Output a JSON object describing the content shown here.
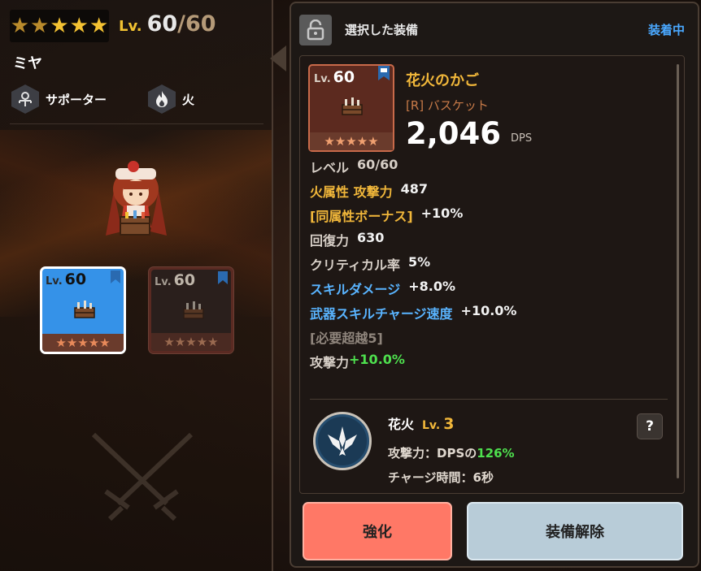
{
  "colors": {
    "accent_gold": "#f1b73a",
    "skill_blue": "#59b4ff",
    "bonus_green": "#4ee04e",
    "equipped_status": "#4aa8ff",
    "upgrade_button": "#ff7866",
    "unequip_button": "#b8ccd8",
    "equipped_slot": "#3592e8"
  },
  "character": {
    "stars": 5,
    "lit_stars": 3,
    "level_label": "Lv.",
    "level": "60",
    "level_max": "/60",
    "name": "ミヤ",
    "role_icon": "support-icon",
    "role": "サポーター",
    "element_icon": "fire-icon",
    "element": "火"
  },
  "slots": [
    {
      "lv_label": "Lv.",
      "level": "60",
      "stars": "★★★★★",
      "state": "equipped",
      "icon": "basket-icon"
    },
    {
      "lv_label": "Lv.",
      "level": "60",
      "stars": "★★★★★",
      "state": "owned",
      "icon": "basket-icon"
    }
  ],
  "panel": {
    "lock_icon": "unlock-icon",
    "title": "選択した装備",
    "status": "装着中"
  },
  "item": {
    "lv_label": "Lv.",
    "level": "60",
    "stars": "★★★★★",
    "name": "花火のかご",
    "type": "[R] バスケット",
    "dps_value": "2,046",
    "dps_unit": "DPS"
  },
  "stats": [
    {
      "label": "レベル",
      "value": "60/60",
      "label_color": "gray",
      "value_color": "white"
    },
    {
      "label": "火属性 攻撃力",
      "value": "487",
      "label_color": "orange",
      "value_color": "white"
    },
    {
      "label": "[同属性ボーナス]",
      "value": "+10%",
      "label_color": "orange",
      "value_color": "white"
    },
    {
      "label": "回復力",
      "value": "630",
      "label_color": "gray",
      "value_color": "white"
    },
    {
      "label": "クリティカル率",
      "value": "5%",
      "label_color": "gray",
      "value_color": "white"
    },
    {
      "label": "スキルダメージ",
      "value": "+8.0%",
      "label_color": "blue",
      "value_color": "white"
    },
    {
      "label": "武器スキルチャージ速度",
      "value": "+10.0%",
      "label_color": "blue",
      "value_color": "white"
    },
    {
      "label": "[必要超越5]",
      "value": "",
      "label_color": "dim",
      "value_color": "white"
    },
    {
      "label": "攻撃力",
      "value": "+10.0%",
      "label_color": "gray",
      "value_color": "green"
    }
  ],
  "skill": {
    "icon": "fireworks-skill-icon",
    "name": "花火",
    "lv_label": "Lv.",
    "level": "3",
    "attack_prefix": "攻撃力：DPSの",
    "attack_value": "126%",
    "charge_label": "チャージ時間：6秒",
    "help_label": "?"
  },
  "buttons": {
    "upgrade": "強化",
    "unequip": "装備解除"
  }
}
